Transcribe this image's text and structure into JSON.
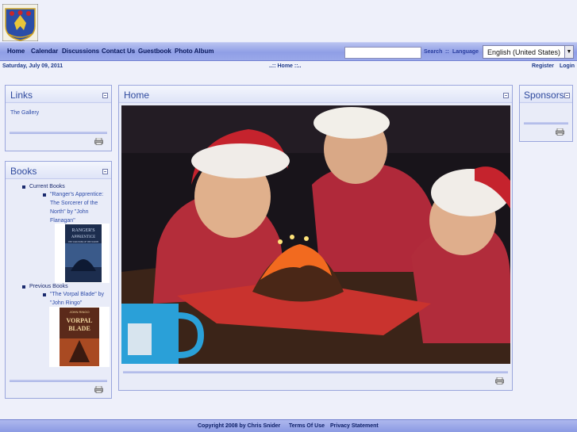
{
  "nav": {
    "items": [
      "Home",
      "Calendar",
      "Discussions",
      "Contact Us",
      "Guestbook",
      "Photo Album"
    ],
    "search_label": "Search",
    "separator": "::",
    "language_label": "Language",
    "language_value": "English (United States)"
  },
  "infobar": {
    "date": "Saturday, July 09, 2011",
    "breadcrumb": "..:: Home ::..",
    "register": "Register",
    "login": "Login"
  },
  "links_panel": {
    "title": "Links",
    "items": [
      "The Gallery"
    ]
  },
  "books_panel": {
    "title": "Books",
    "current_heading": "Current Books",
    "current_book_line1": "\"Ranger's Apprentice:",
    "current_book_line2": "The Sorcerer of the",
    "current_book_line3": "North\" by \"John",
    "current_book_line4": "Flanagan\"",
    "previous_heading": "Previous Books",
    "previous_book_line1": "\"The Vorpal Blade\" by",
    "previous_book_line2": "\"John Ringo\"",
    "cover1_title_top": "RANGER'S",
    "cover1_title_mid": "APPRENTICE",
    "cover1_title_bottom": "THE SORCERER OF THE NORTH",
    "cover2_title_top": "JOHN RINGO",
    "cover2_title_mid": "VORPAL",
    "cover2_title_bottom": "BLADE"
  },
  "home_panel": {
    "title": "Home"
  },
  "sponsors_panel": {
    "title": "Sponsors"
  },
  "footer": {
    "copyright": "Copyright 2008 by Chris Snider",
    "terms": "Terms Of Use",
    "privacy": "Privacy Statement"
  }
}
